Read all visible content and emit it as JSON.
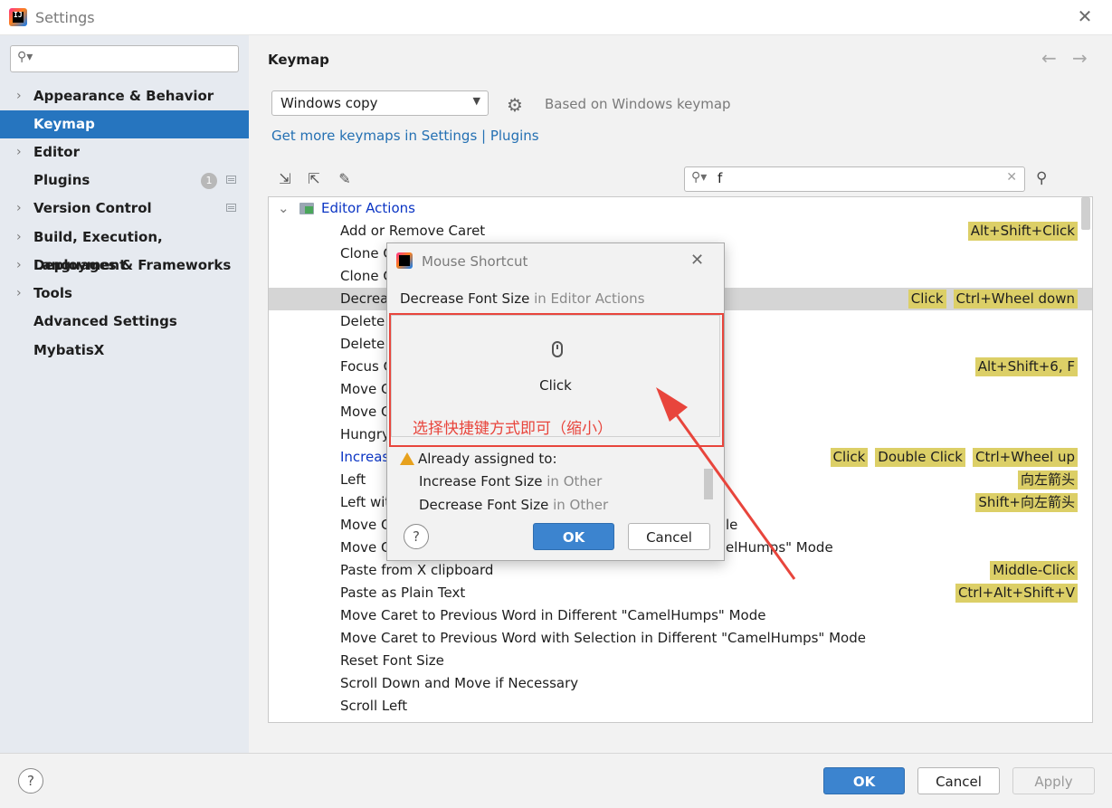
{
  "window": {
    "title": "Settings"
  },
  "sidebar": {
    "search_placeholder": "",
    "items": [
      {
        "label": "Appearance & Behavior",
        "expandable": true
      },
      {
        "label": "Keymap",
        "selected": true
      },
      {
        "label": "Editor",
        "expandable": true
      },
      {
        "label": "Plugins",
        "badge": "1"
      },
      {
        "label": "Version Control",
        "expandable": true
      },
      {
        "label": "Build, Execution, Deployment",
        "expandable": true
      },
      {
        "label": "Languages & Frameworks",
        "expandable": true
      },
      {
        "label": "Tools",
        "expandable": true
      },
      {
        "label": "Advanced Settings"
      },
      {
        "label": "MybatisX"
      }
    ]
  },
  "main": {
    "title": "Keymap",
    "keymap_select": "Windows copy",
    "based_on": "Based on Windows keymap",
    "link": "Get more keymaps in Settings | Plugins",
    "search_value": "f"
  },
  "tree": {
    "group": "Editor Actions",
    "rows": [
      {
        "name": "Add or Remove Caret",
        "shortcuts": [
          "Alt+Shift+Click"
        ]
      },
      {
        "name": "Clone C",
        "shortcuts": []
      },
      {
        "name": "Clone C",
        "shortcuts": []
      },
      {
        "name": "Decrea",
        "shortcuts": [
          "Click",
          "Ctrl+Wheel down"
        ],
        "selected": true
      },
      {
        "name": "Delete",
        "shortcuts": []
      },
      {
        "name": "Delete",
        "shortcuts": []
      },
      {
        "name": "Focus C",
        "shortcuts": [
          "Alt+Shift+6, F"
        ]
      },
      {
        "name": "Move C",
        "shortcuts": []
      },
      {
        "name": "Move C",
        "shortcuts": []
      },
      {
        "name": "Hungry",
        "shortcuts": []
      },
      {
        "name": "Increas",
        "shortcuts": [
          "Click",
          "Double Click",
          "Ctrl+Wheel up"
        ],
        "blue": true
      },
      {
        "name": "Left",
        "shortcuts": [
          "向左箭头"
        ]
      },
      {
        "name": "Left wit",
        "shortcuts": [
          "Shift+向左箭头"
        ]
      },
      {
        "name": "Move C",
        "suffix": "le",
        "shortcuts": []
      },
      {
        "name": "Move C",
        "suffix": "elHumps\" Mode",
        "shortcuts": []
      },
      {
        "name": "Paste from X clipboard",
        "shortcuts": [
          "Middle-Click"
        ]
      },
      {
        "name": "Paste as Plain Text",
        "shortcuts": [
          "Ctrl+Alt+Shift+V"
        ]
      },
      {
        "name": "Move Caret to Previous Word in Different \"CamelHumps\" Mode",
        "shortcuts": []
      },
      {
        "name": "Move Caret to Previous Word with Selection in Different \"CamelHumps\" Mode",
        "shortcuts": []
      },
      {
        "name": "Reset Font Size",
        "shortcuts": []
      },
      {
        "name": "Scroll Down and Move if Necessary",
        "shortcuts": []
      },
      {
        "name": "Scroll Left",
        "shortcuts": []
      }
    ]
  },
  "dialog": {
    "title": "Mouse Shortcut",
    "action": "Decrease Font Size",
    "action_context": "in Editor Actions",
    "click_label": "Click",
    "annotation": "选择快捷键方式即可（缩小）",
    "warning": "Already assigned to:",
    "assigned": [
      {
        "name": "Increase Font Size",
        "context": "in Other"
      },
      {
        "name": "Decrease Font Size",
        "context": "in Other"
      }
    ],
    "ok": "OK",
    "cancel": "Cancel",
    "help": "?"
  },
  "footer": {
    "ok": "OK",
    "cancel": "Cancel",
    "apply": "Apply",
    "help": "?"
  },
  "colors": {
    "accent": "#2675bf",
    "shortcut_chip": "#dccf67",
    "annotation_red": "#e8453c"
  }
}
